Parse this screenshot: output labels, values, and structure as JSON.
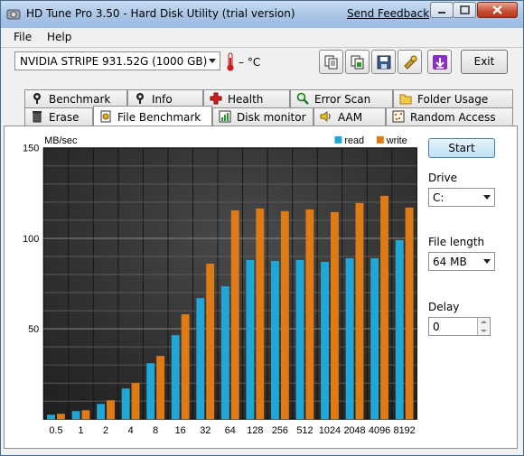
{
  "window": {
    "title": "HD Tune Pro 3.50 - Hard Disk Utility (trial version)",
    "feedback_link": "Send Feedback"
  },
  "menu": {
    "items": [
      "File",
      "Help"
    ]
  },
  "toolbar": {
    "drive": "NVIDIA  STRIPE   931.52G (1000 GB)",
    "temperature": "– °C",
    "exit_label": "Exit",
    "buttons": [
      "copy-text-icon",
      "copy-screenshot-icon",
      "save-icon",
      "options-icon",
      "download-icon"
    ]
  },
  "tabs": {
    "row1": [
      {
        "label": "Benchmark",
        "icon": "benchmark-icon"
      },
      {
        "label": "Info",
        "icon": "info-icon"
      },
      {
        "label": "Health",
        "icon": "health-icon"
      },
      {
        "label": "Error Scan",
        "icon": "error-scan-icon"
      },
      {
        "label": "Folder Usage",
        "icon": "folder-icon"
      }
    ],
    "row2": [
      {
        "label": "Erase",
        "icon": "erase-icon"
      },
      {
        "label": "File Benchmark",
        "icon": "file-benchmark-icon",
        "active": true
      },
      {
        "label": "Disk monitor",
        "icon": "disk-monitor-icon"
      },
      {
        "label": "AAM",
        "icon": "aam-icon"
      },
      {
        "label": "Random Access",
        "icon": "random-access-icon"
      }
    ]
  },
  "controls": {
    "start_label": "Start",
    "drive_label": "Drive",
    "drive_value": "C:",
    "file_length_label": "File length",
    "file_length_value": "64 MB",
    "delay_label": "Delay",
    "delay_value": "0"
  },
  "colors": {
    "read": "#1fa7d8",
    "write": "#e07a14",
    "plot_bg": "#3a3a3a"
  },
  "chart_data": {
    "type": "bar",
    "ylabel": "MB/sec",
    "ylim": [
      0,
      150
    ],
    "yticks": [
      50,
      100,
      150
    ],
    "grid": true,
    "legend_position": "top-right",
    "categories": [
      "0.5",
      "1",
      "2",
      "4",
      "8",
      "16",
      "32",
      "64",
      "128",
      "256",
      "512",
      "1024",
      "2048",
      "4096",
      "8192"
    ],
    "series": [
      {
        "name": "read",
        "values": [
          2.5,
          4.5,
          8.5,
          17,
          31,
          46.5,
          67,
          73.5,
          88,
          87.5,
          88,
          87,
          89,
          89,
          99
        ]
      },
      {
        "name": "write",
        "values": [
          3,
          5,
          10.5,
          20,
          35,
          58,
          86,
          115.5,
          116.5,
          115,
          116,
          114.5,
          119.5,
          123.5,
          117
        ]
      }
    ]
  }
}
